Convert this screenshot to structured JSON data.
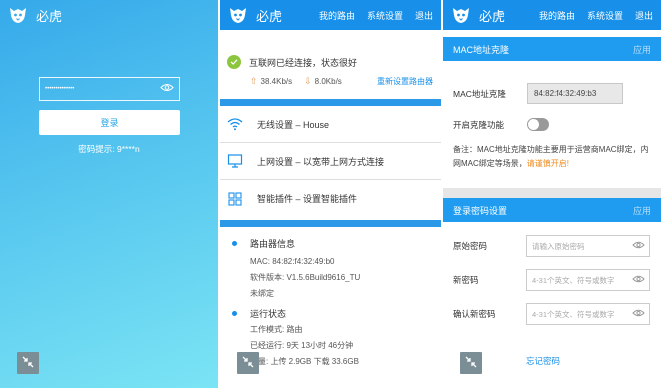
{
  "app": {
    "title": "必虎"
  },
  "login": {
    "password_masked": "••••••••••••••",
    "login_button": "登录",
    "password_hint": "密码提示: 9****n"
  },
  "nav": {
    "my_router": "我的路由",
    "system_settings": "系统设置",
    "logout": "退出"
  },
  "status": {
    "connected_text": "互联网已经连接，状态很好",
    "upload_speed": "38.4Kb/s",
    "download_speed": "8.0Kb/s",
    "reset_link": "重新设置路由器"
  },
  "menu": [
    {
      "label": "无线设置 – House",
      "icon": "wifi-icon"
    },
    {
      "label": "上网设置 – 以宽带上网方式连接",
      "icon": "monitor-icon"
    },
    {
      "label": "智能插件 – 设置智能插件",
      "icon": "grid-icon"
    }
  ],
  "router_info": {
    "title": "路由器信息",
    "mac": "MAC: 84:82:f4:32:49:b0",
    "firmware": "软件版本: V1.5.6Build9616_TU",
    "binding": "未绑定"
  },
  "run_state": {
    "title": "运行状态",
    "mode": "工作模式: 路由",
    "uptime": "已经运行: 9天 13小时 46分钟",
    "traffic": "流量: 上传 2.9GB 下载 33.6GB"
  },
  "mac_clone": {
    "section_title": "MAC地址克隆",
    "apply": "应用",
    "mac_label": "MAC地址克隆",
    "mac_value": "84:82:f4:32:49:b3",
    "enable_label": "开启克隆功能",
    "note_prefix": "备注：MAC地址克隆功能主要用于运营商MAC绑定，内网MAC绑定等场景，",
    "note_warn": "请谨慎开启!"
  },
  "login_pw": {
    "section_title": "登录密码设置",
    "apply": "应用",
    "old_label": "原始密码",
    "old_placeholder": "请输入原始密码",
    "new_label": "新密码",
    "new_placeholder": "4-31个英文、符号或数字",
    "confirm_label": "确认新密码",
    "confirm_placeholder": "4-31个英文、符号或数字",
    "forgot": "忘记密码"
  },
  "colors": {
    "primary": "#1890e9",
    "success": "#8cc63e",
    "warn": "#f08a1c"
  }
}
